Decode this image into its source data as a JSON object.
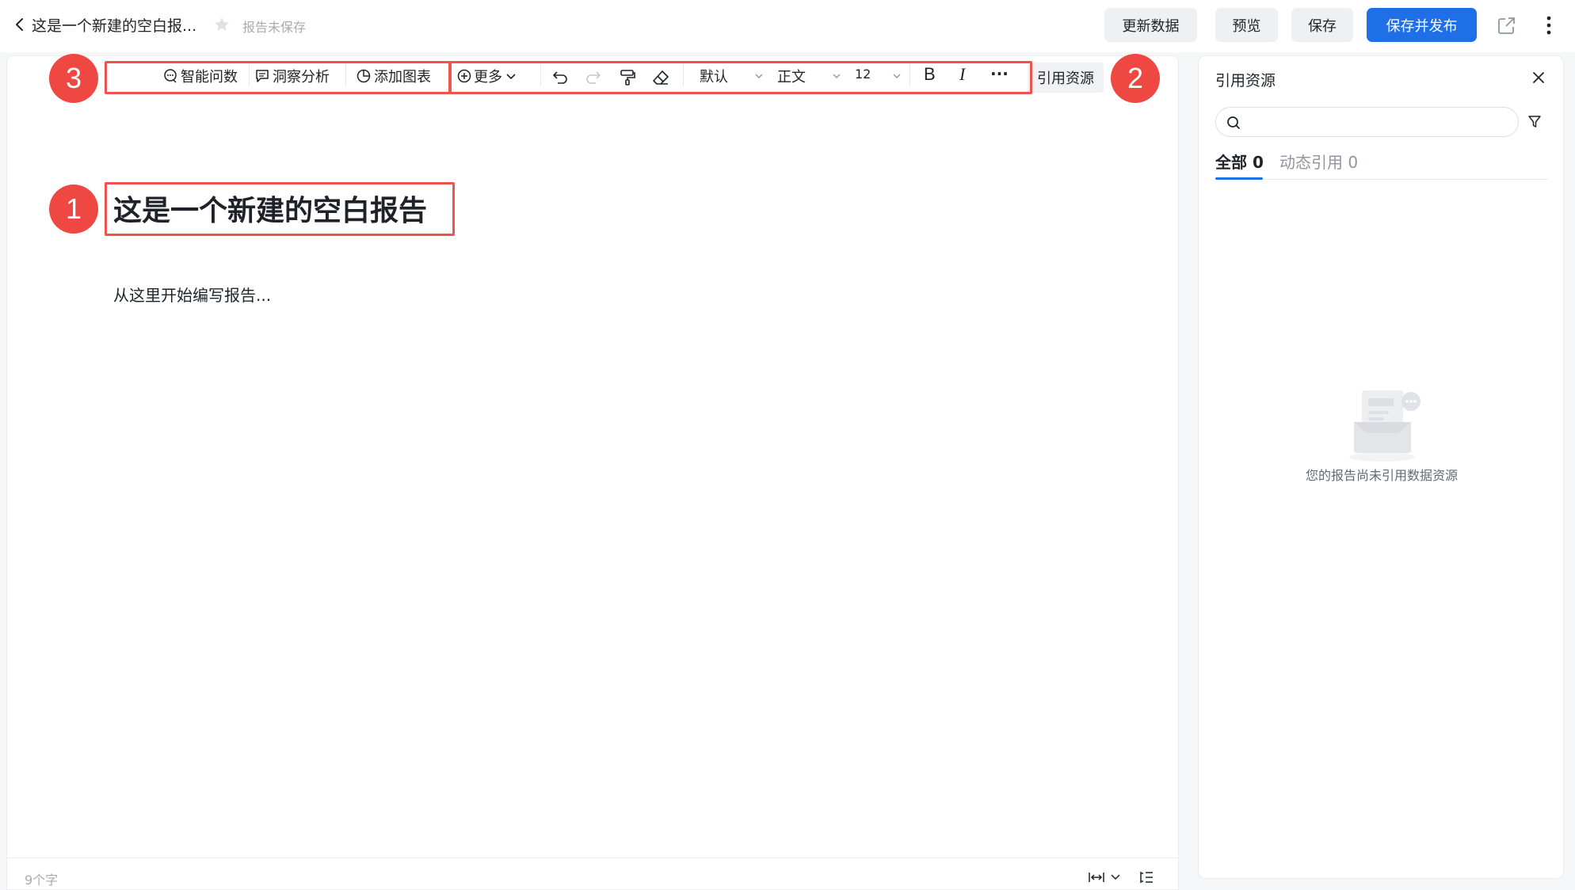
{
  "header": {
    "doc_title": "这是一个新建的空白报...",
    "save_status": "报告未保存",
    "buttons": {
      "refresh": "更新数据",
      "preview": "预览",
      "save": "保存",
      "save_publish": "保存并发布"
    },
    "colors": {
      "primary": "#1f6fe8"
    }
  },
  "toolbar": {
    "smart_qa": "智能问数",
    "insight": "洞察分析",
    "add_chart": "添加图表",
    "more": "更多",
    "style_select": "默认",
    "paragraph_select": "正文",
    "font_size_select": "12",
    "bold": "B",
    "italic": "I",
    "overflow": "···",
    "ref_button": "引用资源"
  },
  "annotations": {
    "badge1": "1",
    "badge2": "2",
    "badge3": "3",
    "color": "#ef4741"
  },
  "editor": {
    "title": "这是一个新建的空白报告",
    "placeholder": "从这里开始编写报告...",
    "word_count": "9个字"
  },
  "panel": {
    "title": "引用资源",
    "search_placeholder": "",
    "tabs": {
      "all": "全部 0",
      "dynamic": "动态引用 0"
    },
    "empty_text": "您的报告尚未引用数据资源"
  },
  "icons": [
    "back-icon",
    "star-icon",
    "share-icon",
    "more-vertical-icon",
    "smart-qa-icon",
    "insight-icon",
    "chart-icon",
    "plus-circle-icon",
    "chevron-down-icon",
    "undo-icon",
    "redo-icon",
    "format-painter-icon",
    "eraser-icon",
    "search-icon",
    "filter-icon",
    "close-icon",
    "fit-width-icon",
    "outline-icon",
    "empty-box-illustration"
  ]
}
